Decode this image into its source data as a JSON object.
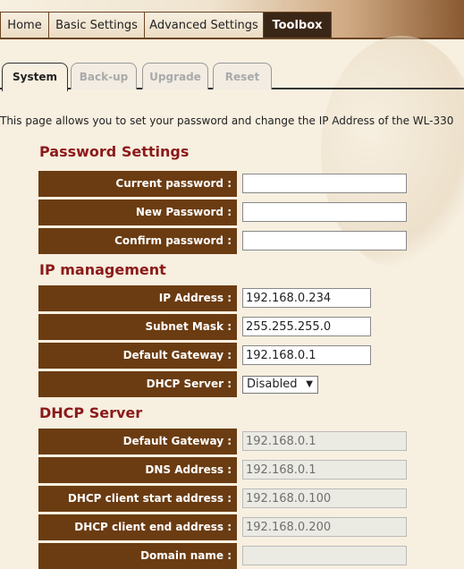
{
  "nav": {
    "items": [
      "Home",
      "Basic Settings",
      "Advanced Settings",
      "Toolbox"
    ],
    "active": "Toolbox"
  },
  "subtabs": {
    "items": [
      "System",
      "Back-up",
      "Upgrade",
      "Reset"
    ],
    "active": "System"
  },
  "intro": "This page allows you to set your password and change the IP Address of the WL-330",
  "password_settings": {
    "title": "Password Settings",
    "current_label": "Current password :",
    "current_value": "",
    "new_label": "New Password :",
    "new_value": "",
    "confirm_label": "Confirm password :",
    "confirm_value": ""
  },
  "ip_management": {
    "title": "IP management",
    "ip_label": "IP Address :",
    "ip_value": "192.168.0.234",
    "mask_label": "Subnet Mask :",
    "mask_value": "255.255.255.0",
    "gateway_label": "Default Gateway :",
    "gateway_value": "192.168.0.1",
    "dhcp_label": "DHCP Server :",
    "dhcp_value": "Disabled"
  },
  "dhcp_server": {
    "title": "DHCP Server",
    "gateway_label": "Default Gateway :",
    "gateway_value": "192.168.0.1",
    "dns_label": "DNS Address :",
    "dns_value": "192.168.0.1",
    "start_label": "DHCP client start address :",
    "start_value": "192.168.0.100",
    "end_label": "DHCP client end address :",
    "end_value": "192.168.0.200",
    "domain_label": "Domain name :",
    "domain_value": ""
  },
  "colors": {
    "label_bg": "#6b3c12",
    "section_title": "#8b1a1a",
    "page_bg": "#f7efe0"
  }
}
